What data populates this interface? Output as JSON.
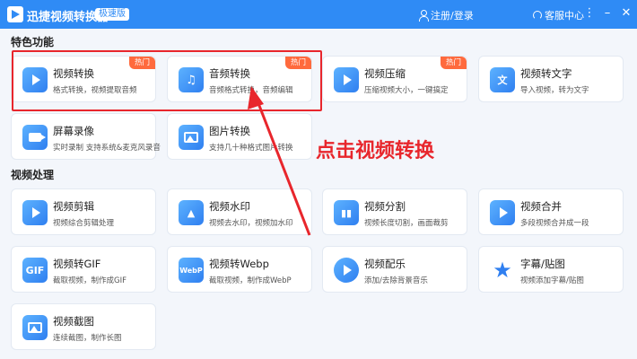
{
  "titlebar": {
    "app_name": "迅捷视频转换器",
    "edition": "极速版",
    "login": "注册/登录",
    "service": "客服中心",
    "minimize": "–",
    "menu": "⋮",
    "close": "✕"
  },
  "sections": {
    "featured": "特色功能",
    "video_processing": "视频处理"
  },
  "featured_cards": [
    {
      "title": "视频转换",
      "desc": "格式转换，视频提取音频",
      "badge": "热门",
      "icon": "video-convert-icon"
    },
    {
      "title": "音频转换",
      "desc": "音频格式转换，音频编辑",
      "badge": "热门",
      "icon": "audio-convert-icon"
    },
    {
      "title": "视频压缩",
      "desc": "压缩视频大小，一键搞定",
      "badge": "热门",
      "icon": "video-compress-icon"
    },
    {
      "title": "视频转文字",
      "desc": "导入视频，转为文字",
      "badge": "",
      "icon": "video-to-text-icon"
    },
    {
      "title": "屏幕录像",
      "desc": "实时录制 支持系统&麦克风录音",
      "badge": "",
      "icon": "screen-record-icon"
    },
    {
      "title": "图片转换",
      "desc": "支持几十种格式图片转换",
      "badge": "",
      "icon": "image-convert-icon"
    }
  ],
  "processing_cards": [
    {
      "title": "视频剪辑",
      "desc": "视频综合剪辑处理",
      "icon": "video-edit-icon"
    },
    {
      "title": "视频水印",
      "desc": "视频去水印，视频加水印",
      "icon": "watermark-icon"
    },
    {
      "title": "视频分割",
      "desc": "视频长度切割，画面裁剪",
      "icon": "video-split-icon"
    },
    {
      "title": "视频合并",
      "desc": "多段视频合并成一段",
      "icon": "video-merge-icon"
    },
    {
      "title": "视频转GIF",
      "desc": "截取视频，制作成GIF",
      "icon": "gif-icon"
    },
    {
      "title": "视频转Webp",
      "desc": "截取视频，制作成WebP",
      "icon": "webp-icon"
    },
    {
      "title": "视频配乐",
      "desc": "添加/去除背景音乐",
      "icon": "music-icon"
    },
    {
      "title": "字幕/贴图",
      "desc": "视频添加字幕/贴图",
      "icon": "subtitle-icon"
    },
    {
      "title": "视频截图",
      "desc": "连续截图，制作长图",
      "icon": "screenshot-icon"
    }
  ],
  "annotation": {
    "text": "点击视频转换"
  },
  "colors": {
    "titlebar": "#2f8bf5",
    "hot_badge": "#ff6a3d",
    "annotation": "#e8262c"
  }
}
